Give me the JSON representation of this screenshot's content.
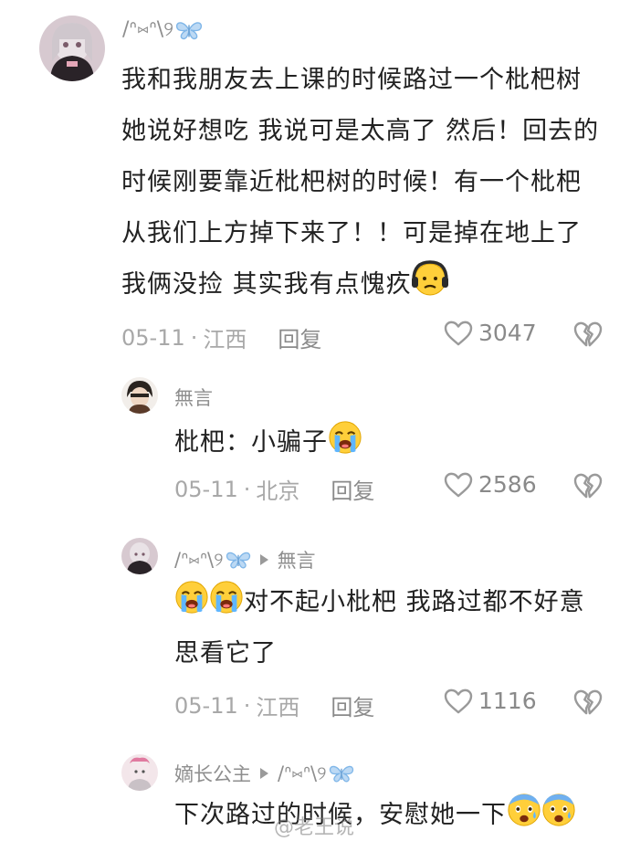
{
  "comments": [
    {
      "author": "/ᐢ⑅ᐢ\\୨",
      "text_lines": [
        "我和我朋友去上课的时候路过一个枇杷树",
        "她说好想吃 我说可是太高了 然后！回去的",
        "时候刚要靠近枇杷树的时候！有一个枇杷",
        "从我们上方掉下来了！！可是掉在地上了",
        "我俩没捡 其实我有点愧疚"
      ],
      "date": "05-11",
      "location": "江西",
      "reply_label": "回复",
      "likes": "3047"
    },
    {
      "author": "無言",
      "text_lines": [
        "枇杷：小骗子"
      ],
      "date": "05-11",
      "location": "北京",
      "reply_label": "回复",
      "likes": "2586"
    },
    {
      "author": "/ᐢ⑅ᐢ\\୨",
      "reply_to": "無言",
      "text_lines": [
        "对不起小枇杷 我路过都不好意",
        "思看它了"
      ],
      "date": "05-11",
      "location": "江西",
      "reply_label": "回复",
      "likes": "1116"
    },
    {
      "author": "嫡长公主",
      "reply_to": "/ᐢ⑅ᐢ\\୨",
      "text_lines": [
        "下次路过的时候，安慰她一下"
      ]
    }
  ],
  "separator": "·",
  "icons": {
    "like": "heart-outline-icon",
    "dislike": "broken-heart-icon",
    "butterfly": "butterfly-icon",
    "emoji_worried": "worried-face-emoji",
    "emoji_crying": "loudly-crying-face-emoji",
    "emoji_fearful": "fearful-face-emoji"
  },
  "colors": {
    "butterfly": "#7fb6e8",
    "meta": "#a8a8a8",
    "text": "#222222"
  },
  "watermark": "@老王说"
}
